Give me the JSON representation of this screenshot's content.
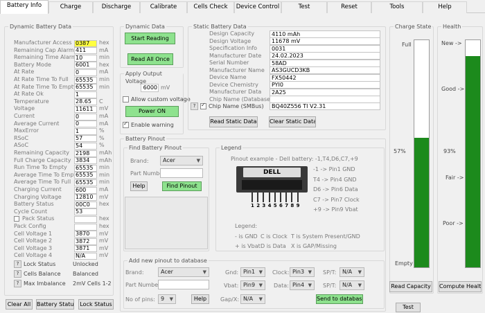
{
  "tabs": [
    "Battery Info",
    "Charge",
    "Discharge",
    "Calibrate",
    "Cells Check",
    "Device Control",
    "Test",
    "Reset",
    "Tools",
    "Help"
  ],
  "dynamic_battery_data": {
    "title": "Dynamic Battery Data",
    "rows": [
      {
        "label": "Manufacturer Access",
        "value": "0387",
        "unit": "hex",
        "highlight": true
      },
      {
        "label": "Remaining Cap Alarm",
        "value": "411",
        "unit": "mA"
      },
      {
        "label": "Remaining Time Alarm",
        "value": "10",
        "unit": "min"
      },
      {
        "label": "Battery Mode",
        "value": "6001",
        "unit": "hex"
      },
      {
        "label": "At Rate",
        "value": "0",
        "unit": "mA"
      },
      {
        "label": "At Rate Time To Full",
        "value": "65535",
        "unit": "min"
      },
      {
        "label": "At Rate Time To Empty",
        "value": "65535",
        "unit": "min"
      },
      {
        "label": "At Rate Ok",
        "value": "1",
        "unit": ""
      },
      {
        "label": "Temperature",
        "value": "28.65",
        "unit": "C"
      },
      {
        "label": "Voltage",
        "value": "11611",
        "unit": "mV"
      },
      {
        "label": "Current",
        "value": "0",
        "unit": "mA"
      },
      {
        "label": "Average Current",
        "value": "0",
        "unit": "mA"
      },
      {
        "label": "MaxError",
        "value": "1",
        "unit": "%"
      },
      {
        "label": "RSoC",
        "value": "57",
        "unit": "%"
      },
      {
        "label": "ASoC",
        "value": "54",
        "unit": "%"
      },
      {
        "label": "Remaining Capacity",
        "value": "2198",
        "unit": "mAh"
      },
      {
        "label": "Full Charge Capacity",
        "value": "3834",
        "unit": "mAh"
      },
      {
        "label": "Run Time To Empty",
        "value": "65535",
        "unit": "min"
      },
      {
        "label": "Average Time To Empty",
        "value": "65535",
        "unit": "min"
      },
      {
        "label": "Average Time To Full",
        "value": "65535",
        "unit": "min"
      },
      {
        "label": "Charging Current",
        "value": "600",
        "unit": "mA"
      },
      {
        "label": "Charging Voltage",
        "value": "12810",
        "unit": "mV"
      },
      {
        "label": "Battery Status",
        "value": "00C0",
        "unit": "hex"
      },
      {
        "label": "Cycle Count",
        "value": "53",
        "unit": ""
      },
      {
        "label": "Pack Status",
        "value": "",
        "unit": "hex",
        "checkbox": true
      },
      {
        "label": "Pack Config",
        "value": "",
        "unit": "hex"
      },
      {
        "label": "Cell Voltage 1",
        "value": "3870",
        "unit": "mV"
      },
      {
        "label": "Cell Voltage 2",
        "value": "3872",
        "unit": "mV"
      },
      {
        "label": "Cell Voltage 3",
        "value": "3871",
        "unit": "mV"
      },
      {
        "label": "Cell Voltage 4",
        "value": "N/A",
        "unit": "mV"
      }
    ],
    "lock_status_label": "Lock Status",
    "lock_status_value": "Unlocked",
    "cells_balance_label": "Cells Balance",
    "cells_balance_value": "Balanced",
    "max_imbalance_label": "Max Imbalance",
    "max_imbalance_value": "2mV Cells 1-2"
  },
  "bottom_buttons": {
    "clear_all": "Clear All",
    "battery_status": "Battery Status",
    "lock_status": "Lock Status"
  },
  "dynamic_data": {
    "title": "Dynamic Data",
    "start_reading": "Start Reading",
    "read_all_once": "Read All Once"
  },
  "apply_output_voltage": {
    "title": "Apply Output Voltage",
    "value": "6000",
    "unit": "mV",
    "allow_custom": "Allow custom voltage",
    "power_on": "Power ON",
    "enable_warning": "Enable warning"
  },
  "static_battery_data": {
    "title": "Static Battery Data",
    "rows": [
      {
        "label": "Design Capacity",
        "value": "4110 mAh"
      },
      {
        "label": "Design Voltage",
        "value": "11678 mV"
      },
      {
        "label": "Specification Info",
        "value": "0031"
      },
      {
        "label": "Manufacturer Date",
        "value": "24.02.2023"
      },
      {
        "label": "Serial Number",
        "value": "58AD"
      },
      {
        "label": "Manufacturer Name",
        "value": "AS3GUCD3KB"
      },
      {
        "label": "Device Name",
        "value": "FX50442"
      },
      {
        "label": "Device Chemistry",
        "value": "PYI0"
      },
      {
        "label": "Manufacturer Data",
        "value": "2A25"
      },
      {
        "label": "Chip Name (Database)",
        "value": ""
      }
    ],
    "chip_name_smbus_label": "Chip Name (SMBus)",
    "chip_name_smbus_value": "BQ40Z556 TI V2.31",
    "read_static": "Read Static Data",
    "clear_static": "Clear Static Data"
  },
  "battery_pinout": {
    "title": "Battery Pinout",
    "find_title": "Find Battery Pinout",
    "brand_label": "Brand:",
    "brand_value": "Acer",
    "part_number_label": "Part Number:",
    "part_number_value": "",
    "help": "Help",
    "find_pinout": "Find Pinout",
    "legend_title": "Legend",
    "pinout_example": "Pinout example - Dell battery:  -1,T4,D6,C7,+9",
    "connector_label": "DELL",
    "pin_numbers": [
      "1",
      "2",
      "3",
      "4",
      "5",
      "6",
      "7",
      "8",
      "9"
    ],
    "pin_notes": [
      "-1 -> Pin1 GND",
      "T4 -> Pin4 GND",
      "D6 -> Pin6 Data",
      "C7 -> Pin7 Clock",
      "+9 -> Pin9 Vbat"
    ],
    "legend_label": "Legend:",
    "legend_row1": [
      "- is GND",
      "C is Clock",
      "T is System Present/GND"
    ],
    "legend_row2": [
      "+ is Vbat",
      "D is Data",
      "X is GAP/Missing"
    ]
  },
  "add_pinout": {
    "title": "Add new pinout to database",
    "brand_label": "Brand:",
    "brand_value": "Acer",
    "part_number_label": "Part Number:",
    "pins_label": "No of pins:",
    "pins_value": "9",
    "help": "Help",
    "gnd_label": "Gnd:",
    "gnd_value": "Pin1",
    "clock_label": "Clock:",
    "clock_value": "Pin3",
    "spt1_label": "SP/T:",
    "spt1_value": "N/A",
    "vbat_label": "Vbat:",
    "vbat_value": "Pin9",
    "data_label": "Data:",
    "data_value": "Pin4",
    "spt2_label": "SP/T:",
    "spt2_value": "N/A",
    "gapx_label": "Gap/X:",
    "gapx_value": "N/A",
    "send": "Send to database"
  },
  "charge_state": {
    "title": "Charge State",
    "full": "Full",
    "empty": "Empty",
    "percent_label": "57%",
    "level": 0.57,
    "read_capacity": "Read Capacity",
    "test": "Test"
  },
  "health": {
    "title": "Health",
    "new": "New ->",
    "good": "Good ->",
    "fair": "Fair ->",
    "poor": "Poor ->",
    "percent_label": "93%",
    "level": 0.93,
    "compute": "Compute Health"
  },
  "colors": {
    "accent_green": "#8ee28e",
    "bar_green": "#1c8a1c",
    "highlight": "#ffff40"
  }
}
